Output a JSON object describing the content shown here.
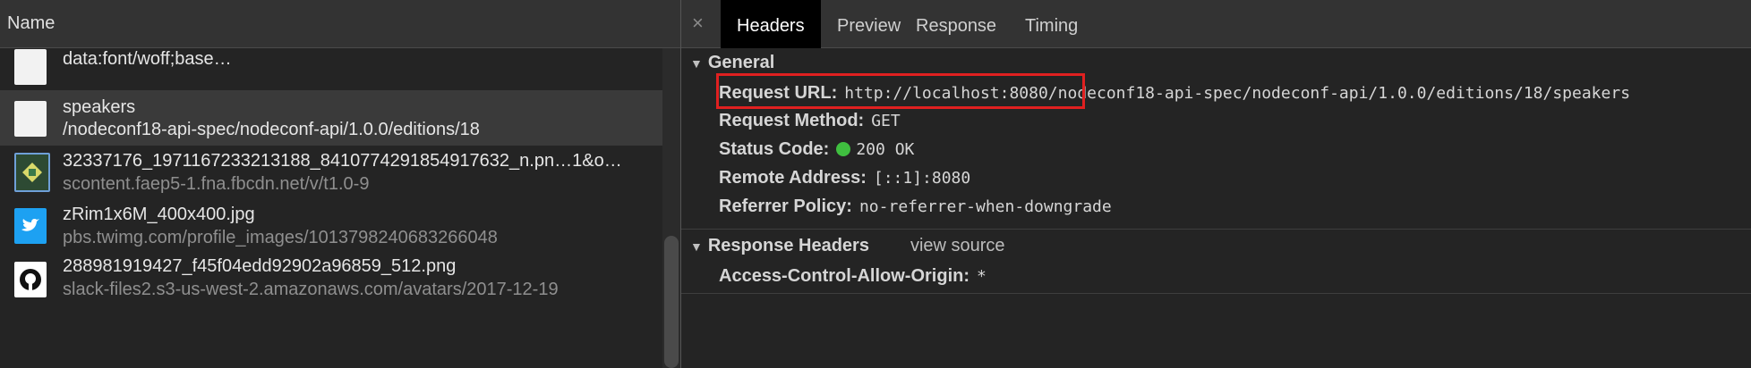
{
  "left_panel": {
    "header": "Name",
    "rows": [
      {
        "name": "data:font/woff;base…",
        "sub": ""
      },
      {
        "name": "speakers",
        "sub": "/nodeconf18-api-spec/nodeconf-api/1.0.0/editions/18"
      },
      {
        "name": "32337176_1971167233213188_8410774291854917632_n.pn…1&o…",
        "sub": "scontent.faep5-1.fna.fbcdn.net/v/t1.0-9"
      },
      {
        "name": "zRim1x6M_400x400.jpg",
        "sub": "pbs.twimg.com/profile_images/1013798240683266048"
      },
      {
        "name": "288981919427_f45f04edd92902a96859_512.png",
        "sub": "slack-files2.s3-us-west-2.amazonaws.com/avatars/2017-12-19"
      }
    ]
  },
  "tabs": {
    "close": "×",
    "items": [
      "Headers",
      "Preview",
      "Response",
      "Timing"
    ],
    "active": "Headers"
  },
  "general": {
    "title": "General",
    "request_url_key": "Request URL:",
    "request_url_val": "http://localhost:8080/nodeconf18-api-spec/nodeconf-api/1.0.0/editions/18/speakers",
    "method_key": "Request Method:",
    "method_val": "GET",
    "status_key": "Status Code:",
    "status_val": "200 OK",
    "status_color": "#3fbf3f",
    "remote_key": "Remote Address:",
    "remote_val": "[::1]:8080",
    "referrer_key": "Referrer Policy:",
    "referrer_val": "no-referrer-when-downgrade"
  },
  "response_headers": {
    "title": "Response Headers",
    "view_source": "view source",
    "acao_key": "Access-Control-Allow-Origin:",
    "acao_val": "*"
  },
  "highlight_color": "#e02020"
}
